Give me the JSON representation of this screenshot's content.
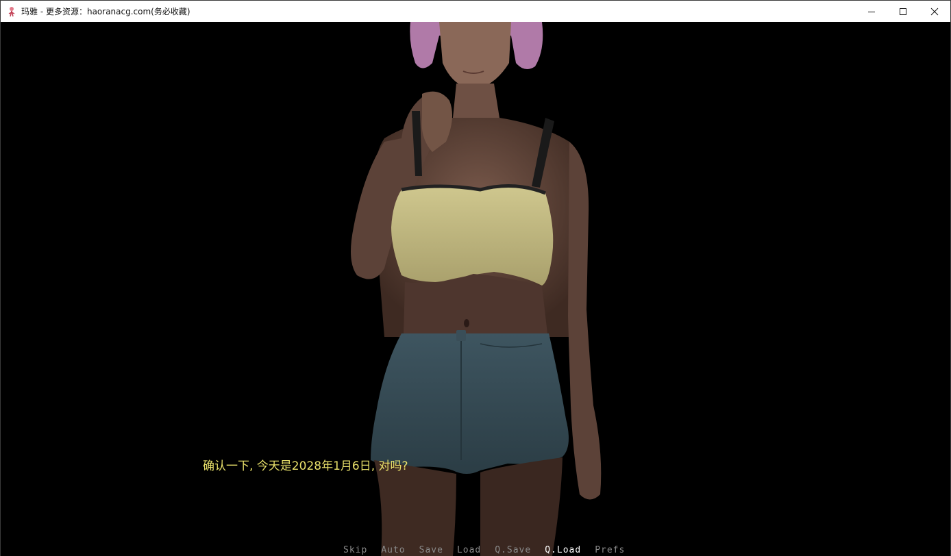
{
  "window": {
    "title": "玛雅 - 更多资源：haoranacg.com(务必收藏)",
    "icon": "game-app-icon",
    "controls": {
      "minimize_icon": "minimize-icon",
      "maximize_icon": "maximize-icon",
      "close_icon": "close-icon"
    }
  },
  "scene": {
    "character_image": "pink-haired-girl-sprite",
    "background_color": "#000000"
  },
  "dialogue": {
    "text": "确认一下, 今天是2028年1月6日, 对吗?",
    "color": "#e8e06a"
  },
  "quick_menu": {
    "items": [
      {
        "label": "Skip"
      },
      {
        "label": "Auto"
      },
      {
        "label": "Save"
      },
      {
        "label": "Load"
      },
      {
        "label": "Q.Save"
      },
      {
        "label": "Q.Load"
      },
      {
        "label": "Prefs"
      }
    ],
    "active_label": "Q.Load",
    "color": "#8a8a8a",
    "active_color": "#ffffff"
  }
}
